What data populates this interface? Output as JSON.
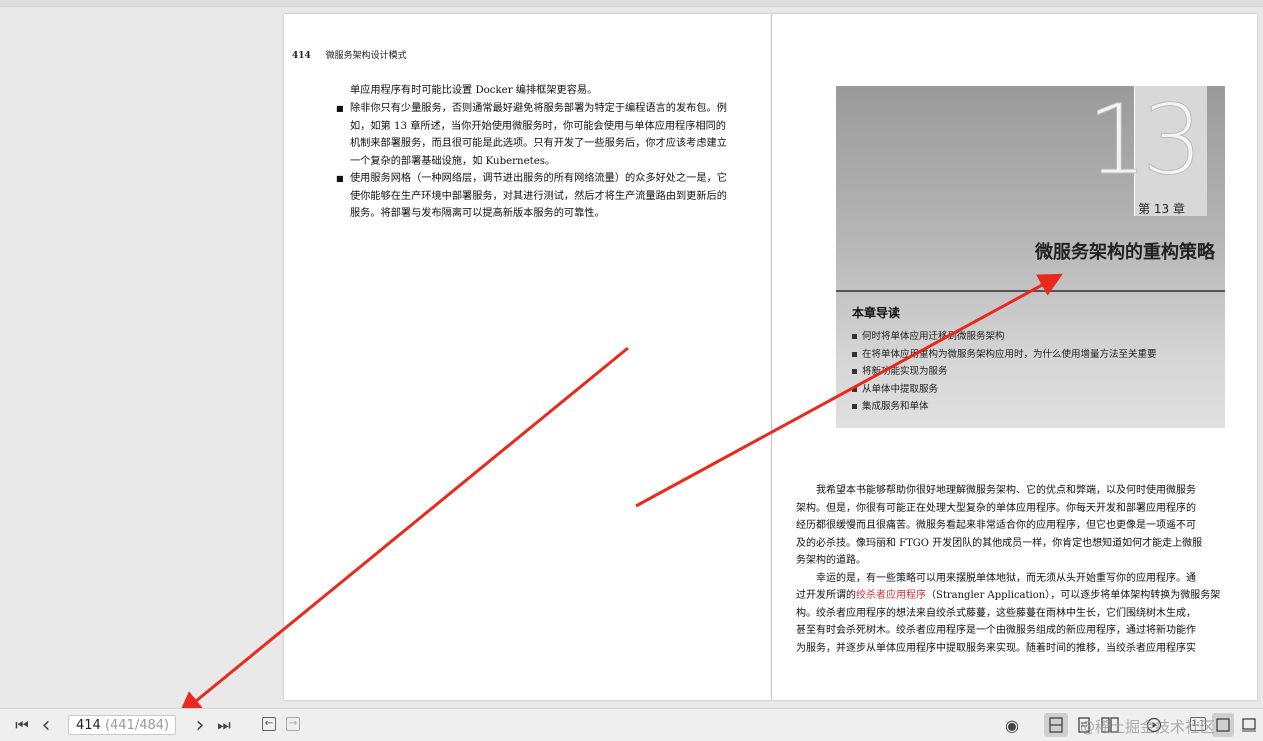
{
  "left_page": {
    "page_number": "414",
    "running_header": "微服务架构设计模式",
    "paragraphs": [
      "单应用程序有时可能比设置 Docker 编排框架更容易。",
      "除非你只有少量服务，否则通常最好避免将服务部署为特定于编程语言的发布包。例",
      "如，如第 13 章所述，当你开始使用微服务时，你可能会使用与单体应用程序相同的",
      "机制来部署服务，而且很可能是此选项。只有开发了一些服务后，你才应该考虑建立",
      "一个复杂的部署基础设施，如 Kubernetes。",
      "使用服务网格（一种网络层，调节进出服务的所有网络流量）的众多好处之一是，它",
      "使你能够在生产环境中部署服务，对其进行测试，然后才将生产流量路由到更新后的",
      "服务。将部署与发布隔离可以提高新版本服务的可靠性。"
    ],
    "bullet_glyph": "■"
  },
  "right_page": {
    "chapter_number": "13",
    "chapter_label": "第 13 章",
    "chapter_title": "微服务架构的重构策略",
    "guide_title": "本章导读",
    "guide_items": [
      "何时将单体应用迁移到微服务架构",
      "在将单体应用重构为微服务架构应用时，为什么使用增量方法至关重要",
      "将新功能实现为服务",
      "从单体中提取服务",
      "集成服务和单体"
    ],
    "body_lines": [
      "我希望本书能够帮助你很好地理解微服务架构、它的优点和弊端，以及何时使用微服务",
      "架构。但是，你很有可能正在处理大型复杂的单体应用程序。你每天开发和部署应用程序的",
      "经历都很缓慢而且很痛苦。微服务看起来非常适合你的应用程序，但它也更像是一项遥不可",
      "及的必杀技。像玛丽和 FTGO 开发团队的其他成员一样，你肯定也想知道如何才能走上微服",
      "务架构的道路。",
      "幸运的是，有一些策略可以用来摆脱单体地狱，而无须从头开始重写你的应用程序。通",
      "过开发所谓的",
      "绞杀者应用程序",
      "（Strangler Application），可以逐步将单体架构转换为微服务架",
      "构。绞杀者应用程序的想法来自绞杀式藤蔓，这些藤蔓在雨林中生长，它们围绕树木生成，",
      "甚至有时会杀死树木。绞杀者应用程序是一个由微服务组成的新应用程序，通过将新功能作",
      "为服务，并逐步从单体应用程序中提取服务来实现。随着时间的推移，当绞杀者应用程序实"
    ]
  },
  "toolbar": {
    "first_page_icon": "⏮",
    "prev_page_icon": "‹",
    "page_input_value": "414",
    "page_position": "(441/484)",
    "next_page_icon": "›",
    "last_page_icon": "⏭",
    "icons": [
      "first-page-icon",
      "prev-page-icon",
      "next-page-icon",
      "last-page-icon",
      "back-icon",
      "forward-icon",
      "eye-icon",
      "single-page-icon",
      "page-icon",
      "two-page-icon",
      "present-icon",
      "play-icon",
      "actual-size-icon",
      "fit-page-icon",
      "fit-width-icon"
    ],
    "actual_size_label": "1:1"
  },
  "watermark": "@稀土掘金技术社区",
  "colors": {
    "arrow": "#e8291c",
    "toolbar_bg": "#efefef",
    "canvas_bg": "#e9e9e9"
  }
}
